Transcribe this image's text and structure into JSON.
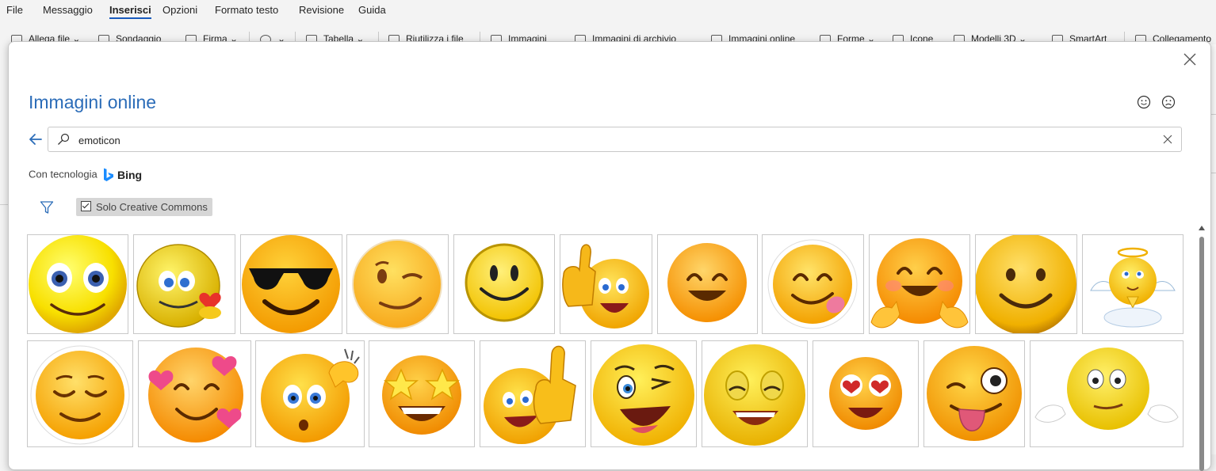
{
  "menu": {
    "items": [
      "File",
      "Messaggio",
      "Inserisci",
      "Opzioni",
      "Formato testo",
      "Revisione",
      "Guida"
    ],
    "active": "Inserisci"
  },
  "toolbar": {
    "items": [
      "Allega file",
      "Sondaggio",
      "Firma",
      "Tabella",
      "Riutilizza i file",
      "Immagini",
      "Immagini di archivio",
      "Immagini online",
      "Forme",
      "Icone",
      "Modelli 3D",
      "SmartArt",
      "Collegamento"
    ]
  },
  "dialog": {
    "title": "Immagini online",
    "search_value": "emoticon",
    "powered_by": "Con tecnologia",
    "bing": "Bing",
    "cc_label": "Solo Creative Commons",
    "icons": {
      "close": "close-icon",
      "feedback_smile": "smile-feedback-icon",
      "feedback_frown": "frown-feedback-icon",
      "back": "back-arrow-icon",
      "search": "search-icon",
      "clear": "clear-icon",
      "filter": "filter-icon"
    }
  },
  "results": {
    "row1": [
      "big-eyes smiley",
      "smiley with heart",
      "sunglasses smiley",
      "winking smiley",
      "simple smiley",
      "thumbs-up laughing",
      "smiling face",
      "tongue smiley",
      "hugging face",
      "slight smile",
      "angel praying"
    ],
    "row2": [
      "relieved face",
      "smiling face with hearts",
      "thinking scratch head",
      "star-struck",
      "thumbs-up smiley",
      "winking laughing",
      "squinting smile",
      "heart eyes",
      "zany tongue face",
      "shrugging smiley"
    ]
  },
  "colors": {
    "accent": "#2b6cb8",
    "emoji_yellow": "#ffd21f",
    "emoji_orange": "#f7a81b"
  }
}
